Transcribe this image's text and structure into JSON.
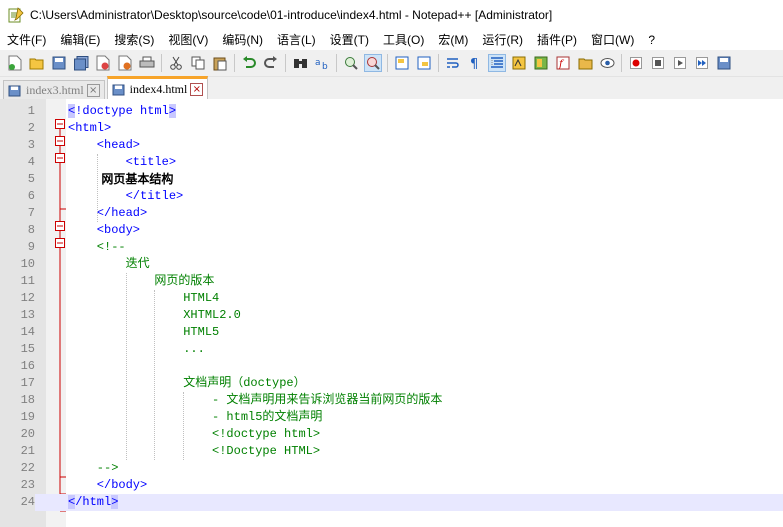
{
  "window": {
    "title": "C:\\Users\\Administrator\\Desktop\\source\\code\\01-introduce\\index4.html - Notepad++ [Administrator]"
  },
  "menu": [
    "文件(F)",
    "编辑(E)",
    "搜索(S)",
    "视图(V)",
    "编码(N)",
    "语言(L)",
    "设置(T)",
    "工具(O)",
    "宏(M)",
    "运行(R)",
    "插件(P)",
    "窗口(W)",
    "?"
  ],
  "tabs": [
    {
      "label": "index3.html",
      "active": false
    },
    {
      "label": "index4.html",
      "active": true
    }
  ],
  "editor": {
    "current_line": 24,
    "lines": [
      {
        "n": "1",
        "text": "<!doctype html>"
      },
      {
        "n": "2",
        "text": "<html>"
      },
      {
        "n": "3",
        "text": "    <head>"
      },
      {
        "n": "4",
        "text": "        <title>"
      },
      {
        "n": "5",
        "text": "        网页基本结构"
      },
      {
        "n": "6",
        "text": "        </title>"
      },
      {
        "n": "7",
        "text": "    </head>"
      },
      {
        "n": "8",
        "text": "    <body>"
      },
      {
        "n": "9",
        "text": "    <!--"
      },
      {
        "n": "10",
        "text": "        迭代"
      },
      {
        "n": "11",
        "text": "            网页的版本"
      },
      {
        "n": "12",
        "text": "                HTML4"
      },
      {
        "n": "13",
        "text": "                XHTML2.0"
      },
      {
        "n": "14",
        "text": "                HTML5"
      },
      {
        "n": "15",
        "text": "                ..."
      },
      {
        "n": "16",
        "text": ""
      },
      {
        "n": "17",
        "text": "                文档声明（doctype）"
      },
      {
        "n": "18",
        "text": "                    - 文档声明用来告诉浏览器当前网页的版本"
      },
      {
        "n": "19",
        "text": "                    - html5的文档声明"
      },
      {
        "n": "20",
        "text": "                    <!doctype html>"
      },
      {
        "n": "21",
        "text": "                    <!Doctype HTML>"
      },
      {
        "n": "22",
        "text": "    -->"
      },
      {
        "n": "23",
        "text": "    </body>"
      },
      {
        "n": "24",
        "text": "</html>"
      }
    ]
  },
  "colors": {
    "tag": "#0000ff",
    "comment": "#008000",
    "current_line": "#e8e8ff",
    "fold_line": "#cc0000",
    "active_tab_accent": "#f7a42a"
  }
}
